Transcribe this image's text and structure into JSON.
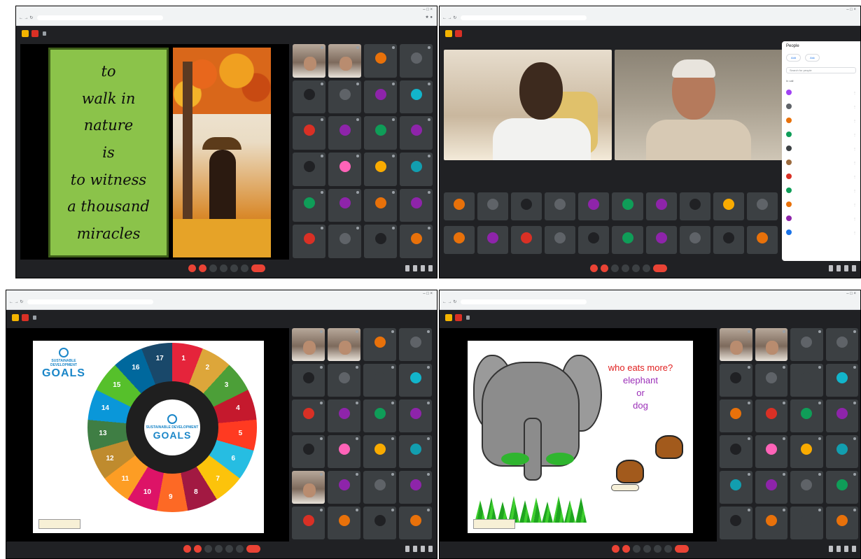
{
  "panels": [
    {
      "id": "top-left",
      "browser": {
        "tabs": [
          "Meet – ...",
          "New tab"
        ],
        "url": "meet.google.com/..."
      },
      "meeting_title": "",
      "slide": {
        "type": "quote",
        "lines": [
          "to",
          "walk in",
          "nature",
          "is",
          "to witness",
          "a thousand",
          "miracles"
        ]
      },
      "tiles": [
        "",
        "",
        "",
        "",
        "",
        "",
        "",
        "",
        "",
        "",
        "",
        "",
        "",
        "",
        "",
        "",
        "",
        "",
        "",
        "",
        "",
        "",
        "",
        ""
      ],
      "avatar_colors": [
        "photo",
        "photo",
        "#e8710a",
        "#5f6368",
        "#202124",
        "#5f6368",
        "#8e24aa",
        "#12b5cb",
        "#d93025",
        "#8e24aa",
        "#0f9d58",
        "#8e24aa",
        "#202124",
        "#ff63b8",
        "#f9ab00",
        "#129eaf",
        "#0f9d58",
        "#8e24aa",
        "#e8710a",
        "#8e24aa",
        "#d93025",
        "#5f6368",
        "#202124",
        "#e8710a"
      ]
    },
    {
      "id": "top-right",
      "people_panel": {
        "title": "People",
        "add_label": "Add",
        "ask_label": "Ask",
        "search_placeholder": "Search for people",
        "section": "In call",
        "participant_colors": [
          "#a142f4",
          "#5f6368",
          "#e8710a",
          "#0f9d58",
          "#3c4043",
          "#9c6b3e",
          "#d93025",
          "#0f9d58",
          "#e8710a",
          "#8e24aa",
          "#1a73e8"
        ]
      },
      "cams": [
        "",
        ""
      ],
      "strip_colors": [
        [
          "#e8710a",
          "#5f6368",
          "#202124",
          "#5f6368",
          "#8e24aa",
          "#0f9d58",
          "#8e24aa",
          "#202124",
          "#f9ab00",
          "#5f6368"
        ],
        [
          "#e8710a",
          "#8e24aa",
          "#d93025",
          "#5f6368",
          "#202124",
          "#0f9d58",
          "#8e24aa",
          "#5f6368",
          "#202124",
          "#e8710a"
        ]
      ]
    },
    {
      "id": "bottom-left",
      "slide": {
        "type": "sdg",
        "logo_sub": "SUSTAINABLE DEVELOPMENT",
        "logo_main": "GOALS",
        "core_sub": "SUSTAINABLE DEVELOPMENT",
        "core_main": "GOALS",
        "goal_numbers": [
          "1",
          "2",
          "3",
          "4",
          "5",
          "6",
          "7",
          "8",
          "9",
          "10",
          "11",
          "12",
          "13",
          "14",
          "15",
          "16",
          "17"
        ]
      },
      "avatar_colors": [
        "photo",
        "photo",
        "#e8710a",
        "#5f6368",
        "#202124",
        "#5f6368",
        "#3c4043",
        "#12b5cb",
        "#d93025",
        "#8e24aa",
        "#0f9d58",
        "#8e24aa",
        "#202124",
        "#ff63b8",
        "#f9ab00",
        "#129eaf",
        "photo",
        "#8e24aa",
        "#5f6368",
        "#8e24aa",
        "#d93025",
        "#e8710a",
        "#202124",
        "#e8710a"
      ]
    },
    {
      "id": "bottom-right",
      "slide": {
        "type": "quiz",
        "question": "who eats more?",
        "option_a": "elephant",
        "connector": "or",
        "option_b": "dog"
      },
      "avatar_colors": [
        "photo",
        "photo",
        "#5f6368",
        "#5f6368",
        "#202124",
        "#5f6368",
        "#3c4043",
        "#12b5cb",
        "#e8710a",
        "#d93025",
        "#0f9d58",
        "#8e24aa",
        "#202124",
        "#ff63b8",
        "#f9ab00",
        "#129eaf",
        "#129eaf",
        "#8e24aa",
        "#5f6368",
        "#0f9d58",
        "#202124",
        "#e8710a",
        "#3c4043",
        "#e8710a"
      ]
    }
  ]
}
